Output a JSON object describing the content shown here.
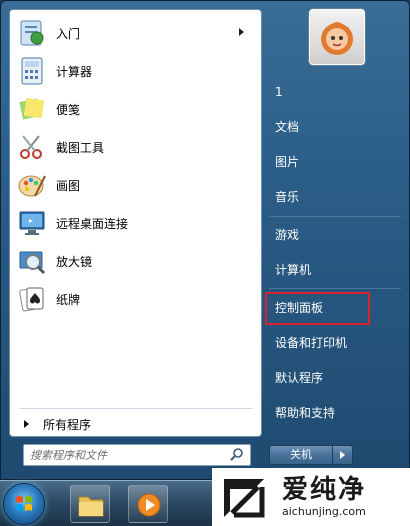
{
  "programs": [
    {
      "label": "入门",
      "icon": "getting-started-icon",
      "has_submenu": true
    },
    {
      "label": "计算器",
      "icon": "calculator-icon"
    },
    {
      "label": "便笺",
      "icon": "sticky-notes-icon"
    },
    {
      "label": "截图工具",
      "icon": "snipping-tool-icon"
    },
    {
      "label": "画图",
      "icon": "paint-icon"
    },
    {
      "label": "远程桌面连接",
      "icon": "remote-desktop-icon"
    },
    {
      "label": "放大镜",
      "icon": "magnifier-icon"
    },
    {
      "label": "纸牌",
      "icon": "solitaire-icon"
    }
  ],
  "all_programs": {
    "label": "所有程序"
  },
  "search": {
    "placeholder": "搜索程序和文件"
  },
  "right_items": [
    {
      "label": "1"
    },
    {
      "label": "文档"
    },
    {
      "label": "图片"
    },
    {
      "label": "音乐"
    },
    {
      "label": "游戏"
    },
    {
      "label": "计算机"
    },
    {
      "label": "控制面板"
    },
    {
      "label": "设备和打印机"
    },
    {
      "label": "默认程序"
    },
    {
      "label": "帮助和支持"
    }
  ],
  "shutdown": {
    "label": "关机"
  },
  "watermark": {
    "brand": "爱纯净",
    "url": "aichunjing.com"
  },
  "colors": {
    "highlight": "#d8242c",
    "menu_blue": "#2b5e88"
  }
}
